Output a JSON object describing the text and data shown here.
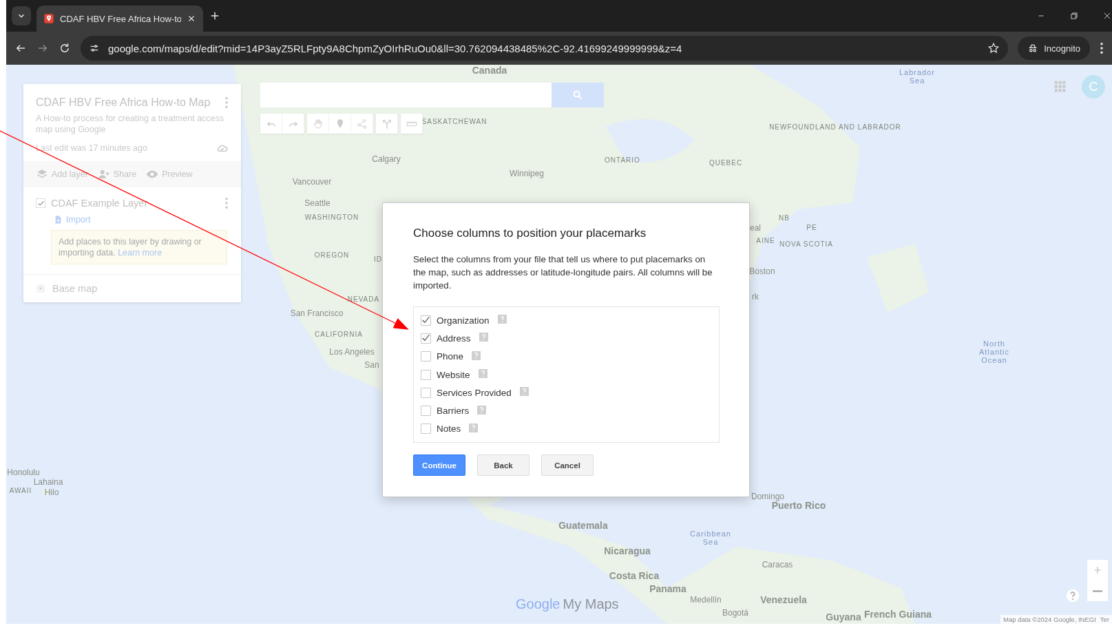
{
  "browser": {
    "tab_title": "CDAF HBV Free Africa How-to",
    "url": "google.com/maps/d/edit?mid=14P3ayZ5RLFpty9A8ChpmZyOIrhRuOu0&ll=30.762094438485%2C-92.41699249999999&z=4",
    "profile": "Incognito"
  },
  "map_panel": {
    "title": "CDAF HBV Free Africa How-to Map",
    "description": "A How-to process for creating a treatment access map using Google",
    "last_edit": "Last edit was 17 minutes ago",
    "actions": [
      "Add layer",
      "Share",
      "Preview"
    ],
    "layer": {
      "name": "CDAF Example Layer",
      "checked": true,
      "import": "Import",
      "hint": "Add places to this layer by drawing or importing data.",
      "hint_link": "Learn more"
    },
    "base_map": "Base map"
  },
  "avatar": "C",
  "map_labels": [
    {
      "text": "Canada",
      "kind": "country"
    },
    {
      "text": "SASKATCHEWAN",
      "kind": "region"
    },
    {
      "text": "Calgary",
      "kind": "city"
    },
    {
      "text": "Winnipeg",
      "kind": "city"
    },
    {
      "text": "ONTARIO",
      "kind": "region"
    },
    {
      "text": "QUEBEC",
      "kind": "region"
    },
    {
      "text": "NEWFOUNDLAND AND LABRADOR",
      "kind": "region"
    },
    {
      "text": "Labrador Sea",
      "kind": "water"
    },
    {
      "text": "Vancouver",
      "kind": "city"
    },
    {
      "text": "Seattle",
      "kind": "city"
    },
    {
      "text": "WASHINGTON",
      "kind": "region"
    },
    {
      "text": "OREGON",
      "kind": "region"
    },
    {
      "text": "ID",
      "kind": "region"
    },
    {
      "text": "NEVADA",
      "kind": "region"
    },
    {
      "text": "San Francisco",
      "kind": "city"
    },
    {
      "text": "CALIFORNIA",
      "kind": "region"
    },
    {
      "text": "Los Angeles",
      "kind": "city"
    },
    {
      "text": "San",
      "kind": "city"
    },
    {
      "text": "eal",
      "kind": "city"
    },
    {
      "text": "NB",
      "kind": "region"
    },
    {
      "text": "PE",
      "kind": "region"
    },
    {
      "text": "AINE",
      "kind": "region"
    },
    {
      "text": "NOVA SCOTIA",
      "kind": "region"
    },
    {
      "text": "Boston",
      "kind": "city"
    },
    {
      "text": "rk",
      "kind": "city"
    },
    {
      "text": "North Atlantic Ocean",
      "kind": "water"
    },
    {
      "text": "Honolulu",
      "kind": "city"
    },
    {
      "text": "Lahaina",
      "kind": "city"
    },
    {
      "text": "AWAII",
      "kind": "region"
    },
    {
      "text": "Hilo",
      "kind": "city"
    },
    {
      "text": "Domingo",
      "kind": "city"
    },
    {
      "text": "Puerto Rico",
      "kind": "country"
    },
    {
      "text": "Caribbean Sea",
      "kind": "water"
    },
    {
      "text": "Guatemala",
      "kind": "country"
    },
    {
      "text": "Nicaragua",
      "kind": "country"
    },
    {
      "text": "Costa Rica",
      "kind": "country"
    },
    {
      "text": "Panama",
      "kind": "country"
    },
    {
      "text": "Caracas",
      "kind": "city"
    },
    {
      "text": "Medellín",
      "kind": "city"
    },
    {
      "text": "Venezuela",
      "kind": "country"
    },
    {
      "text": "Bogotá",
      "kind": "city"
    },
    {
      "text": "Guyana",
      "kind": "country"
    },
    {
      "text": "French Guiana",
      "kind": "country"
    }
  ],
  "logo": {
    "brand": "Google",
    "product": "My Maps"
  },
  "attribution": "Map data ©2024 Google, INEGI",
  "terms": "Ter",
  "dialog": {
    "title": "Choose columns to position your placemarks",
    "text": "Select the columns from your file that tell us where to put placemarks on the map, such as addresses or latitude-longitude pairs. All columns will be imported.",
    "columns": [
      {
        "label": "Organization",
        "checked": true
      },
      {
        "label": "Address",
        "checked": true
      },
      {
        "label": "Phone",
        "checked": false
      },
      {
        "label": "Website",
        "checked": false
      },
      {
        "label": "Services Provided",
        "checked": false
      },
      {
        "label": "Barriers",
        "checked": false
      },
      {
        "label": "Notes",
        "checked": false
      }
    ],
    "buttons": [
      {
        "label": "Continue",
        "kind": "primary"
      },
      {
        "label": "Back",
        "kind": "secondary"
      },
      {
        "label": "Cancel",
        "kind": "secondary"
      }
    ]
  }
}
